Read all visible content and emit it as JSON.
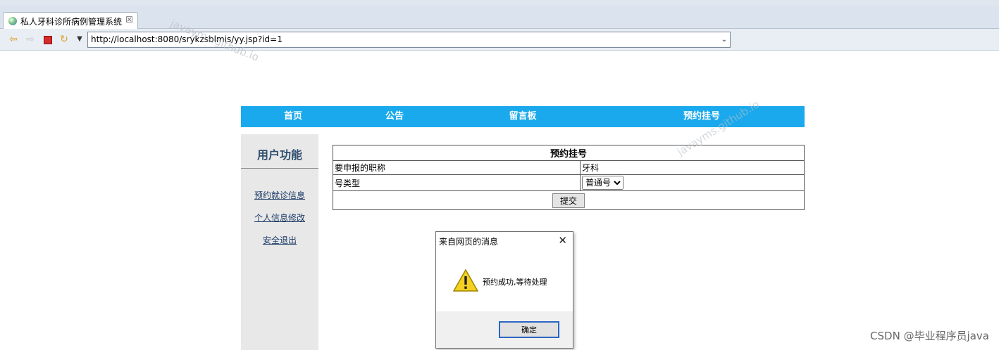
{
  "browser": {
    "tab_title": "私人牙科诊所病例管理系统",
    "tab_close": "☒",
    "url": "http://localhost:8080/srykzsblmis/yy.jsp?id=1"
  },
  "nav": {
    "items": [
      "首页",
      "公告",
      "留言板",
      "预约挂号"
    ]
  },
  "sidebar": {
    "title": "用户功能",
    "links": [
      "预约就诊信息",
      "个人信息修改",
      "安全退出"
    ]
  },
  "form": {
    "caption": "预约挂号",
    "title_label": "要申报的职称",
    "title_value": "牙科",
    "type_label": "号类型",
    "type_selected": "普通号",
    "submit_label": "提交"
  },
  "dialog": {
    "title": "来自网页的消息",
    "message": "预约成功,等待处理",
    "ok_label": "确定"
  },
  "watermarks": {
    "diag": "javayms.github.io",
    "corner": "CSDN @毕业程序员java"
  }
}
